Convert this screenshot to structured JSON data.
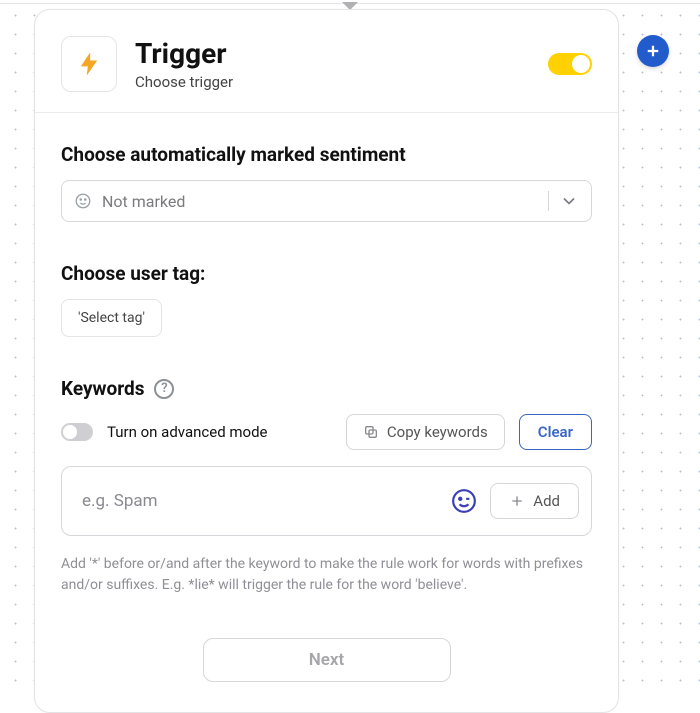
{
  "header": {
    "title": "Trigger",
    "subtitle": "Choose trigger",
    "enabled": true
  },
  "sentiment": {
    "label": "Choose automatically marked sentiment",
    "value": "Not marked"
  },
  "userTag": {
    "label": "Choose user tag:",
    "placeholder": "'Select tag'"
  },
  "keywords": {
    "label": "Keywords",
    "advancedLabel": "Turn on advanced mode",
    "copyLabel": "Copy keywords",
    "clearLabel": "Clear",
    "inputPlaceholder": "e.g. Spam",
    "addLabel": "Add",
    "hint": "Add '*' before or/and after the keyword to make the rule work for words with prefixes and/or suffixes. E.g. *lie* will trigger the rule for the word 'believe'."
  },
  "nextLabel": "Next"
}
